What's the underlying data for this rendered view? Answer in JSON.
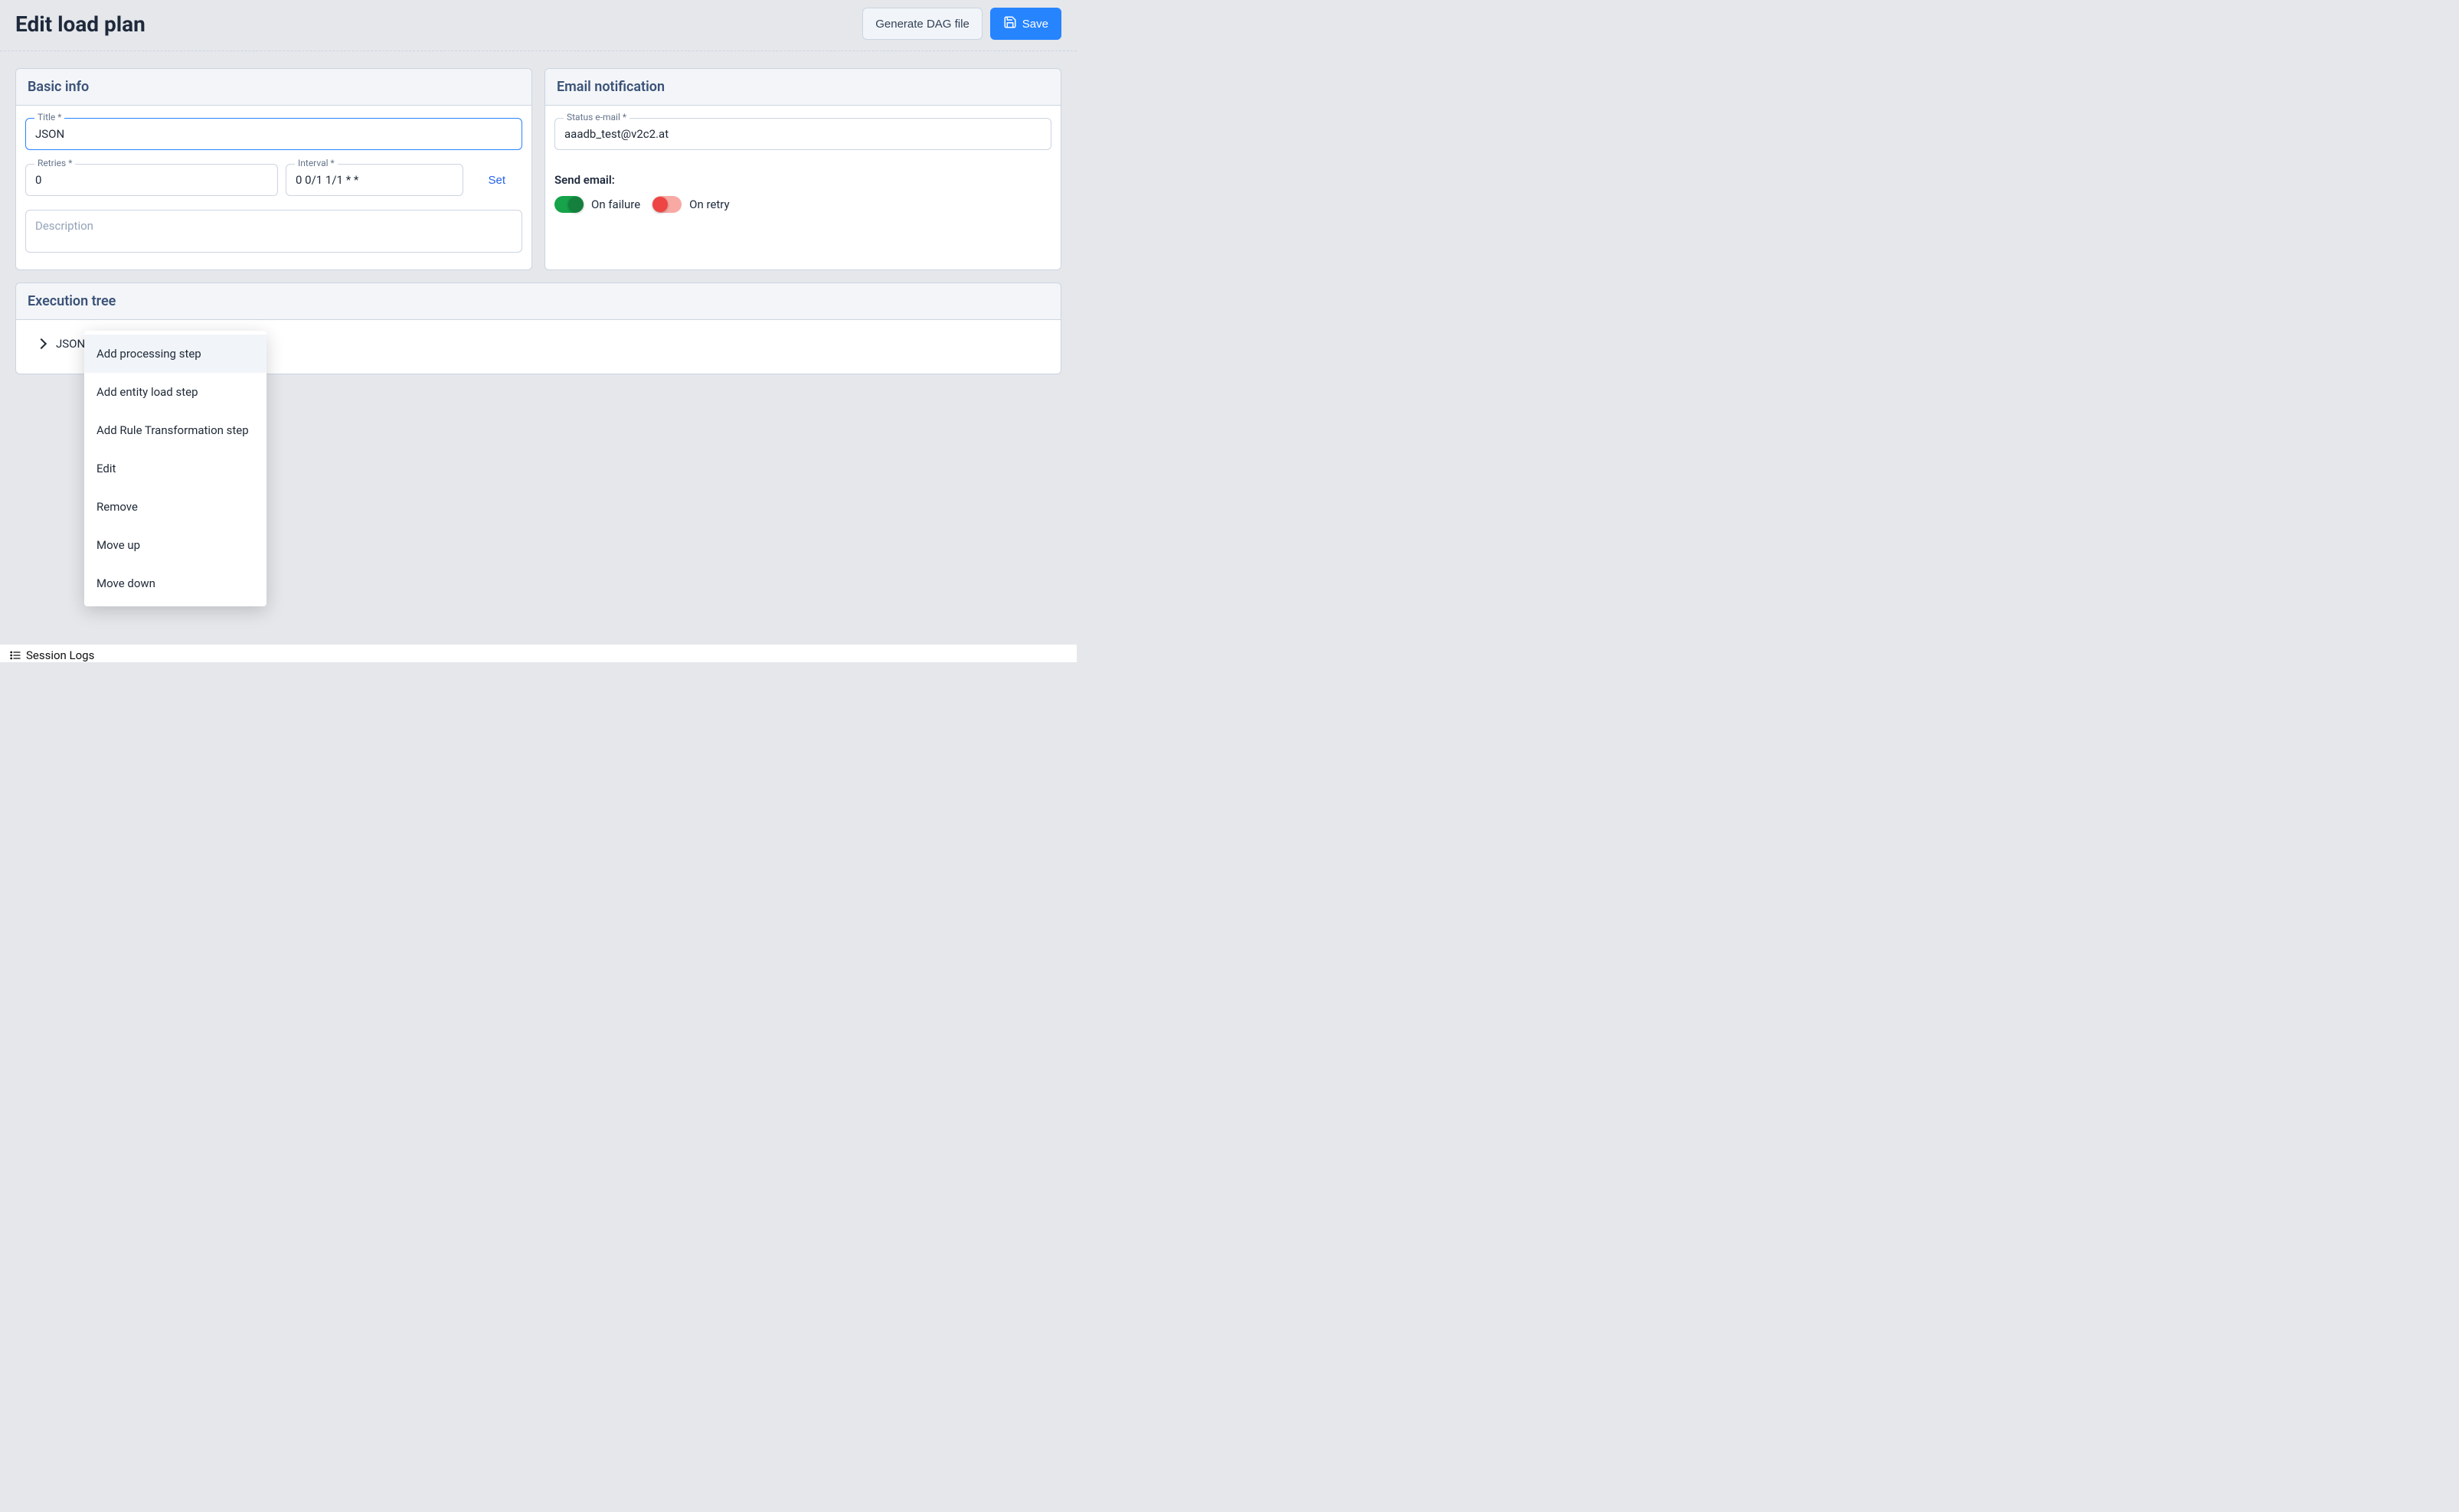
{
  "header": {
    "title": "Edit load plan",
    "generate_label": "Generate DAG file",
    "save_label": "Save"
  },
  "basic_info": {
    "title": "Basic info",
    "title_label": "Title *",
    "title_value": "JSON",
    "retries_label": "Retries *",
    "retries_value": "0",
    "interval_label": "Interval *",
    "interval_value": "0 0/1 1/1 * *",
    "set_label": "Set",
    "description_placeholder": "Description"
  },
  "email": {
    "title": "Email notification",
    "status_label": "Status e-mail *",
    "status_value": "aaadb_test@v2c2.at",
    "send_label": "Send email:",
    "on_failure_label": "On failure",
    "on_retry_label": "On retry"
  },
  "execution_tree": {
    "title": "Execution tree",
    "root": "JSON"
  },
  "context_menu": {
    "add_processing": "Add processing step",
    "add_entity": "Add entity load step",
    "add_rule": "Add Rule Transformation step",
    "edit": "Edit",
    "remove": "Remove",
    "move_up": "Move up",
    "move_down": "Move down"
  },
  "footer": {
    "session_logs": "Session Logs"
  }
}
